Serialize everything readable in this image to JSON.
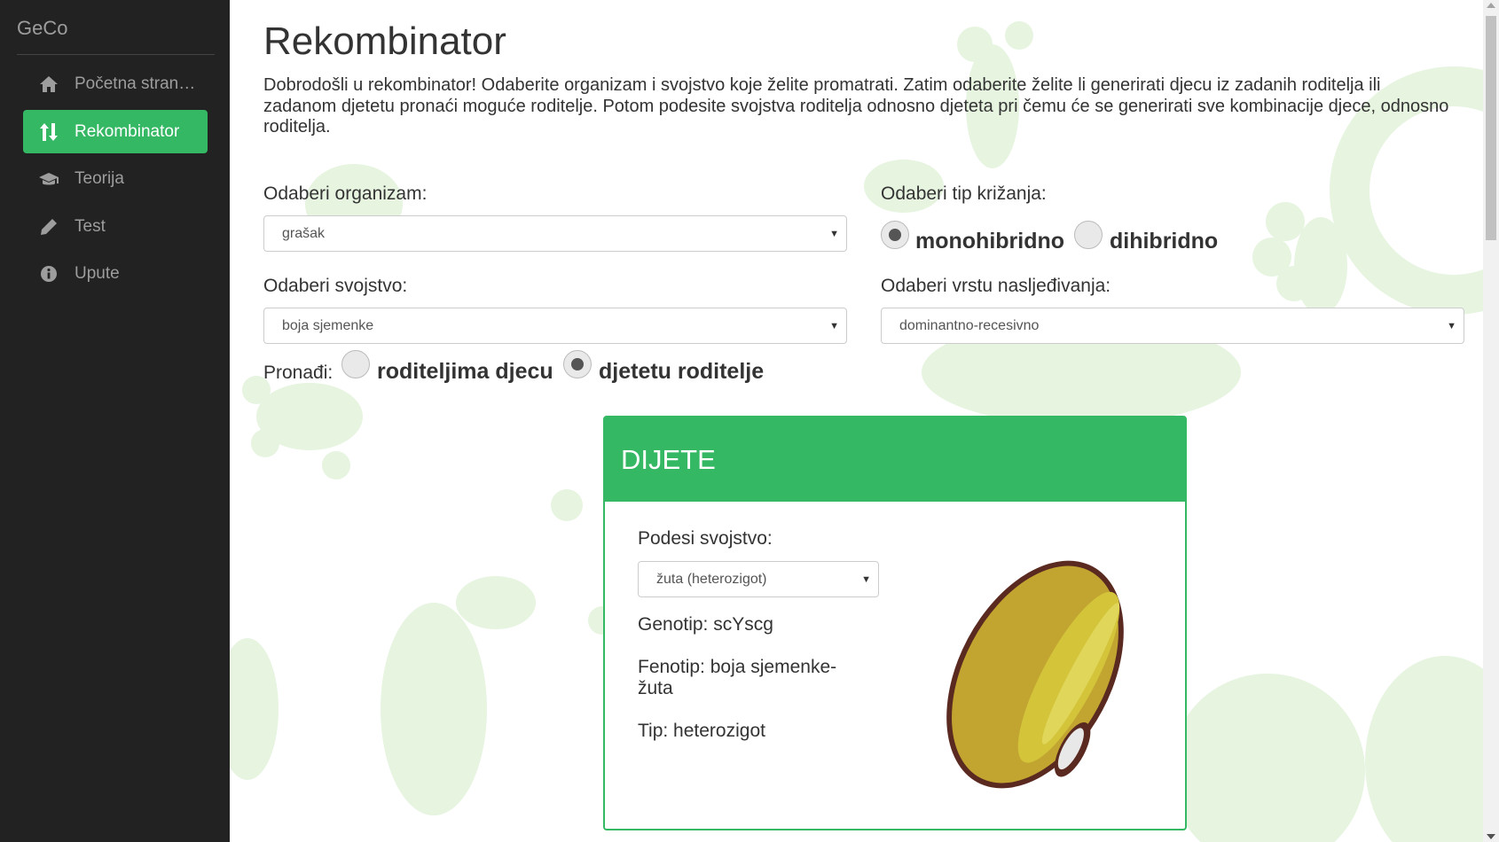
{
  "sidebar": {
    "brand": "GeCo",
    "items": [
      {
        "label": "Početna stranica",
        "icon": "home-icon",
        "active": false
      },
      {
        "label": "Rekombinator",
        "icon": "sort-arrows-icon",
        "active": true
      },
      {
        "label": "Teorija",
        "icon": "graduation-cap-icon",
        "active": false
      },
      {
        "label": "Test",
        "icon": "pencil-icon",
        "active": false
      },
      {
        "label": "Upute",
        "icon": "info-icon",
        "active": false
      }
    ]
  },
  "main": {
    "title": "Rekombinator",
    "intro": "Dobrodošli u rekombinator! Odaberite organizam i svojstvo koje želite promatrati. Zatim odaberite želite li generirati djecu iz zadanih roditelja ili zadanom djetetu pronaći moguće roditelje. Potom podesite svojstva roditelja odnosno djeteta pri čemu će se generirati sve kombinacije djece, odnosno roditelja.",
    "organism": {
      "label": "Odaberi organizam:",
      "value": "grašak"
    },
    "cross_type": {
      "label": "Odaberi tip križanja:",
      "options": [
        {
          "label": "monohibridno",
          "checked": true
        },
        {
          "label": "dihibridno",
          "checked": false
        }
      ]
    },
    "trait": {
      "label": "Odaberi svojstvo:",
      "value": "boja sjemenke"
    },
    "inheritance": {
      "label": "Odaberi vrstu nasljeđivanja:",
      "value": "dominantno-recesivno"
    },
    "find": {
      "label": "Pronađi:",
      "options": [
        {
          "label": "roditeljima djecu",
          "checked": false
        },
        {
          "label": "djetetu roditelje",
          "checked": true
        }
      ]
    },
    "child_panel": {
      "header": "DIJETE",
      "trait_label": "Podesi svojstvo:",
      "trait_value": "žuta (heterozigot)",
      "genotype": "Genotip: scYscg",
      "phenotype": "Fenotip: boja sjemenke-žuta",
      "type": "Tip: heterozigot",
      "image": "yellow-seed-icon"
    }
  },
  "colors": {
    "sidebar_bg": "#222222",
    "accent": "#35b864",
    "background_decoration": "#e6f4e0"
  }
}
